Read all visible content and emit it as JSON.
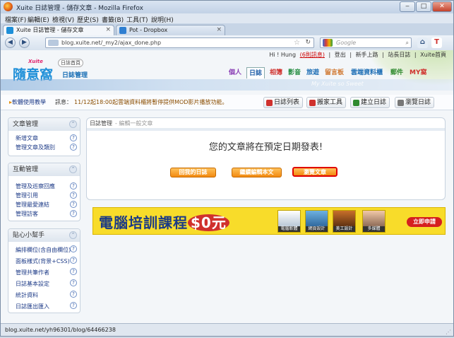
{
  "window": {
    "title": "Xuite 日誌管理 - 儲存文章 - Mozilla Firefox",
    "min": "‒",
    "max": "□",
    "close": "✕"
  },
  "menu": [
    "檔案(F)",
    "編輯(E)",
    "檢視(V)",
    "歷史(S)",
    "書籤(B)",
    "工具(T)",
    "說明(H)"
  ],
  "tabs": [
    {
      "label": "Xuite 日誌管理 - 儲存文章",
      "active": true
    },
    {
      "label": "Pot - Dropbox",
      "active": false
    }
  ],
  "newtab": "+",
  "nav": {
    "back": "◀",
    "forward": "▶",
    "url": "blog.xuite.net/_my2/ajax_done.php",
    "search_placeholder": "Google",
    "addon1": "⌂",
    "addon2": "T"
  },
  "site": {
    "top_links": [
      "Hi ! Hung",
      "(6則訊息)",
      "|",
      "登出",
      "|",
      "新手上路",
      "|",
      "站長日誌",
      "|",
      "Xuite首頁"
    ],
    "logo": {
      "big": "隨意窩",
      "xuite": "Xuite",
      "home": "日誌首頁",
      "sub": "日誌管理"
    },
    "services": [
      "個人",
      "日誌",
      "相簿",
      "影音",
      "旅遊",
      "留言板",
      "雲端資料櫃",
      "郵件",
      "MY窩"
    ],
    "banner_text": "My Xuite so Sweet"
  },
  "notice": {
    "help": "軟體使用教學",
    "label": "訊息：",
    "message": "11/12起18:00起雲端資料櫃將暫停提供MOD影片播放功能。"
  },
  "toolbar": [
    "日誌列表",
    "搬家工具",
    "建立日誌",
    "瀏覽日誌"
  ],
  "sidebar": [
    {
      "title": "文章管理",
      "items": [
        "新增文章",
        "管理文章及類別"
      ]
    },
    {
      "title": "互動管理",
      "items": [
        "管理及巡察回應",
        "管理引用",
        "管理最愛連結",
        "管理訪客"
      ]
    },
    {
      "title": "貼心小幫手",
      "items": [
        "編排欄位(含自由欄位)",
        "面板樣式(背景+CSS)",
        "管理共筆作者",
        "日誌基本設定",
        "統計資料",
        "日誌匯出匯入"
      ]
    }
  ],
  "content": {
    "crumb": "日誌管理",
    "crumb_sub": "- 編輯一般文章",
    "message": "您的文章將在預定日期發表!",
    "buttons": [
      "回我的日誌",
      "繼續編輯本文",
      "瀏覽文章"
    ]
  },
  "ad": {
    "title": "電腦培訓課程",
    "price": "$0元",
    "images": [
      "電腦軟體",
      "網頁設計",
      "美工設計",
      "多媒體"
    ],
    "cta": "立即申請"
  },
  "status": "blog.xuite.net/yh96301/blog/64466238"
}
